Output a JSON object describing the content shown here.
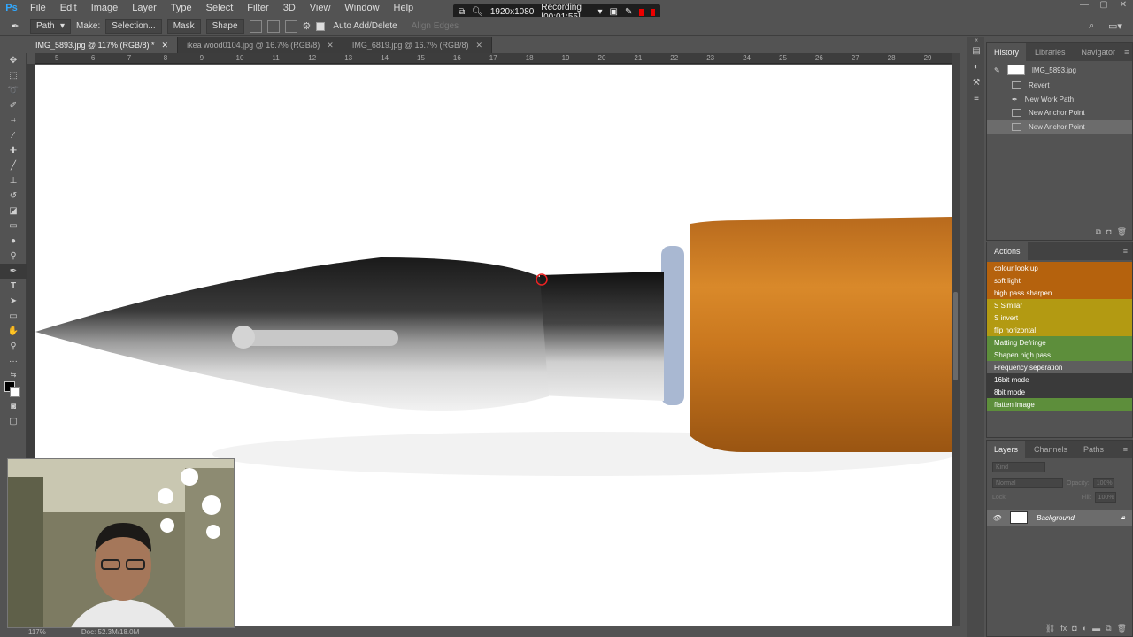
{
  "app": {
    "logo": "Ps"
  },
  "menu": [
    "File",
    "Edit",
    "Image",
    "Layer",
    "Type",
    "Select",
    "Filter",
    "3D",
    "View",
    "Window",
    "Help"
  ],
  "window_controls": [
    "—",
    "▢",
    "✕"
  ],
  "recorder": {
    "resolution": "1920x1080",
    "status": "Recording [00:01:55]"
  },
  "options": {
    "tool_mode": "Path",
    "make_label": "Make:",
    "selection_btn": "Selection...",
    "mask_btn": "Mask",
    "shape_btn": "Shape",
    "auto_add_delete": "Auto Add/Delete",
    "align_edges": "Align Edges"
  },
  "tabs": [
    {
      "label": "IMG_5893.jpg @ 117% (RGB/8) *",
      "close": "✕",
      "active": true
    },
    {
      "label": "ikea wood0104.jpg @ 16.7% (RGB/8)",
      "close": "✕",
      "active": false
    },
    {
      "label": "IMG_6819.jpg @ 16.7% (RGB/8)",
      "close": "✕",
      "active": false
    }
  ],
  "ruler_numbers": [
    "5",
    "6",
    "7",
    "8",
    "9",
    "10",
    "11",
    "12",
    "13",
    "14",
    "15",
    "16",
    "17",
    "18",
    "19",
    "20",
    "21",
    "22",
    "23",
    "24",
    "25",
    "26",
    "27",
    "28",
    "29"
  ],
  "status": {
    "zoom": "117%",
    "doc": "Doc: 52.3M/18.0M"
  },
  "history": {
    "tabs": [
      "History",
      "Libraries",
      "Navigator"
    ],
    "snapshot_name": "IMG_5893.jpg",
    "items": [
      {
        "label": "Revert",
        "selected": false
      },
      {
        "label": "New Work Path",
        "selected": false
      },
      {
        "label": "New Anchor Point",
        "selected": false
      },
      {
        "label": "New Anchor Point",
        "selected": true
      }
    ]
  },
  "actions": {
    "title": "Actions",
    "items": [
      {
        "label": "colour look up",
        "color": "#b5620d"
      },
      {
        "label": "soft light",
        "color": "#b5620d"
      },
      {
        "label": "high pass sharpen",
        "color": "#b5620d"
      },
      {
        "label": "S Similar",
        "color": "#b39a12"
      },
      {
        "label": "S invert",
        "color": "#b39a12"
      },
      {
        "label": "flip horizontal",
        "color": "#b39a12"
      },
      {
        "label": "Matting Defringe",
        "color": "#5d8e3b"
      },
      {
        "label": "Shapen high pass",
        "color": "#5d8e3b"
      },
      {
        "label": "Frequency seperation",
        "color": "#5e5e5e"
      },
      {
        "label": "16bit mode",
        "color": "#3a3a3a"
      },
      {
        "label": "8bit mode",
        "color": "#3a3a3a"
      },
      {
        "label": "flatten image",
        "color": "#5d8e3b"
      }
    ]
  },
  "layers": {
    "tabs": [
      "Layers",
      "Channels",
      "Paths"
    ],
    "kind_placeholder": "Kind",
    "blend_mode": "Normal",
    "opacity_label": "Opacity:",
    "opacity_value": "100%",
    "lock_label": "Lock:",
    "fill_label": "Fill:",
    "fill_value": "100%",
    "layer_name": "Background"
  }
}
